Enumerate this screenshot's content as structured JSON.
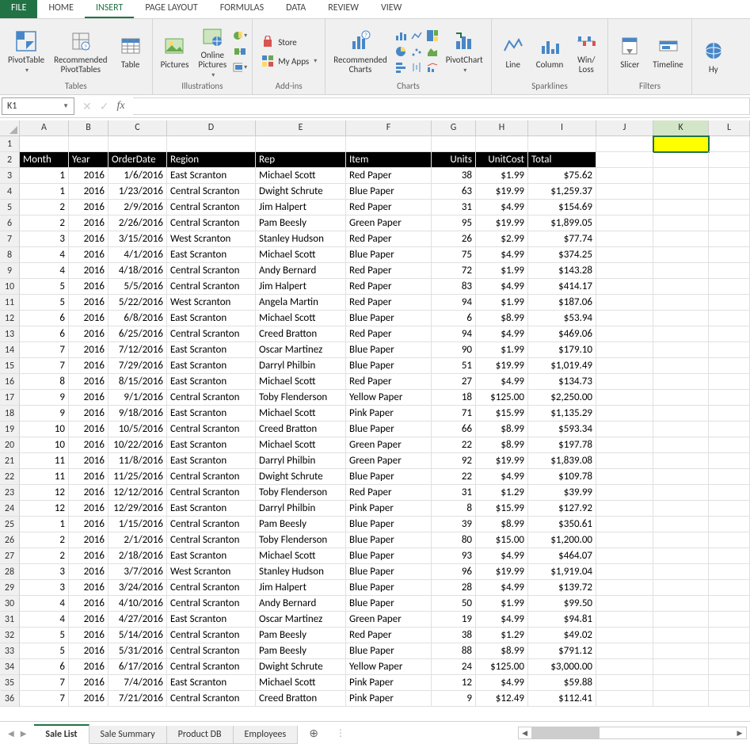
{
  "tabs": {
    "file": "FILE",
    "home": "HOME",
    "insert": "INSERT",
    "page_layout": "PAGE LAYOUT",
    "formulas": "FORMULAS",
    "data": "DATA",
    "review": "REVIEW",
    "view": "VIEW",
    "active": "INSERT"
  },
  "ribbon": {
    "tables": {
      "label": "Tables",
      "pivot": "PivotTable",
      "recommended": "Recommended\nPivotTables",
      "table": "Table"
    },
    "illustrations": {
      "label": "Illustrations",
      "pictures": "Pictures",
      "online": "Online\nPictures"
    },
    "addins": {
      "label": "Add-ins",
      "store": "Store",
      "myapps": "My Apps"
    },
    "charts": {
      "label": "Charts",
      "recommended": "Recommended\nCharts",
      "pivotchart": "PivotChart"
    },
    "sparklines": {
      "label": "Sparklines",
      "line": "Line",
      "column": "Column",
      "winloss": "Win/\nLoss"
    },
    "filters": {
      "label": "Filters",
      "slicer": "Slicer",
      "timeline": "Timeline"
    },
    "links": {
      "label": "",
      "hyperlink": "Hy"
    }
  },
  "name_box": "K1",
  "formula_bar": "",
  "columns": [
    "A",
    "B",
    "C",
    "D",
    "E",
    "F",
    "G",
    "H",
    "I",
    "J",
    "K",
    "L"
  ],
  "selected_col": "K",
  "headers": [
    "Month",
    "Year",
    "OrderDate",
    "Region",
    "Rep",
    "Item",
    "Units",
    "UnitCost",
    "Total"
  ],
  "header_align": [
    "l",
    "l",
    "l",
    "l",
    "l",
    "l",
    "r",
    "r",
    "l"
  ],
  "col_align": [
    "r",
    "r",
    "r",
    "l",
    "l",
    "l",
    "r",
    "r",
    "r"
  ],
  "rows": [
    {
      "n": 3,
      "c": [
        "1",
        "2016",
        "1/6/2016",
        "East Scranton",
        "Michael Scott",
        "Red Paper",
        "38",
        "$1.99",
        "$75.62"
      ]
    },
    {
      "n": 4,
      "c": [
        "1",
        "2016",
        "1/23/2016",
        "Central Scranton",
        "Dwight Schrute",
        "Blue Paper",
        "63",
        "$19.99",
        "$1,259.37"
      ]
    },
    {
      "n": 5,
      "c": [
        "2",
        "2016",
        "2/9/2016",
        "Central Scranton",
        "Jim Halpert",
        "Red Paper",
        "31",
        "$4.99",
        "$154.69"
      ]
    },
    {
      "n": 6,
      "c": [
        "2",
        "2016",
        "2/26/2016",
        "Central Scranton",
        "Pam Beesly",
        "Green Paper",
        "95",
        "$19.99",
        "$1,899.05"
      ]
    },
    {
      "n": 7,
      "c": [
        "3",
        "2016",
        "3/15/2016",
        "West Scranton",
        "Stanley Hudson",
        "Red Paper",
        "26",
        "$2.99",
        "$77.74"
      ]
    },
    {
      "n": 8,
      "c": [
        "4",
        "2016",
        "4/1/2016",
        "East Scranton",
        "Michael Scott",
        "Blue Paper",
        "75",
        "$4.99",
        "$374.25"
      ]
    },
    {
      "n": 9,
      "c": [
        "4",
        "2016",
        "4/18/2016",
        "Central Scranton",
        "Andy Bernard",
        "Red Paper",
        "72",
        "$1.99",
        "$143.28"
      ]
    },
    {
      "n": 10,
      "c": [
        "5",
        "2016",
        "5/5/2016",
        "Central Scranton",
        "Jim Halpert",
        "Red Paper",
        "83",
        "$4.99",
        "$414.17"
      ]
    },
    {
      "n": 11,
      "c": [
        "5",
        "2016",
        "5/22/2016",
        "West Scranton",
        "Angela Martin",
        "Red Paper",
        "94",
        "$1.99",
        "$187.06"
      ]
    },
    {
      "n": 12,
      "c": [
        "6",
        "2016",
        "6/8/2016",
        "East Scranton",
        "Michael Scott",
        "Blue Paper",
        "6",
        "$8.99",
        "$53.94"
      ]
    },
    {
      "n": 13,
      "c": [
        "6",
        "2016",
        "6/25/2016",
        "Central Scranton",
        "Creed Bratton",
        "Red Paper",
        "94",
        "$4.99",
        "$469.06"
      ]
    },
    {
      "n": 14,
      "c": [
        "7",
        "2016",
        "7/12/2016",
        "East Scranton",
        "Oscar Martinez",
        "Blue Paper",
        "90",
        "$1.99",
        "$179.10"
      ]
    },
    {
      "n": 15,
      "c": [
        "7",
        "2016",
        "7/29/2016",
        "East Scranton",
        "Darryl Philbin",
        "Blue Paper",
        "51",
        "$19.99",
        "$1,019.49"
      ]
    },
    {
      "n": 16,
      "c": [
        "8",
        "2016",
        "8/15/2016",
        "East Scranton",
        "Michael Scott",
        "Red Paper",
        "27",
        "$4.99",
        "$134.73"
      ]
    },
    {
      "n": 17,
      "c": [
        "9",
        "2016",
        "9/1/2016",
        "Central Scranton",
        "Toby Flenderson",
        "Yellow Paper",
        "18",
        "$125.00",
        "$2,250.00"
      ]
    },
    {
      "n": 18,
      "c": [
        "9",
        "2016",
        "9/18/2016",
        "East Scranton",
        "Michael Scott",
        "Pink Paper",
        "71",
        "$15.99",
        "$1,135.29"
      ]
    },
    {
      "n": 19,
      "c": [
        "10",
        "2016",
        "10/5/2016",
        "Central Scranton",
        "Creed Bratton",
        "Blue Paper",
        "66",
        "$8.99",
        "$593.34"
      ]
    },
    {
      "n": 20,
      "c": [
        "10",
        "2016",
        "10/22/2016",
        "East Scranton",
        "Michael Scott",
        "Green Paper",
        "22",
        "$8.99",
        "$197.78"
      ]
    },
    {
      "n": 21,
      "c": [
        "11",
        "2016",
        "11/8/2016",
        "East Scranton",
        "Darryl Philbin",
        "Green Paper",
        "92",
        "$19.99",
        "$1,839.08"
      ]
    },
    {
      "n": 22,
      "c": [
        "11",
        "2016",
        "11/25/2016",
        "Central Scranton",
        "Dwight Schrute",
        "Blue Paper",
        "22",
        "$4.99",
        "$109.78"
      ]
    },
    {
      "n": 23,
      "c": [
        "12",
        "2016",
        "12/12/2016",
        "Central Scranton",
        "Toby Flenderson",
        "Red Paper",
        "31",
        "$1.29",
        "$39.99"
      ]
    },
    {
      "n": 24,
      "c": [
        "12",
        "2016",
        "12/29/2016",
        "East Scranton",
        "Darryl Philbin",
        "Pink Paper",
        "8",
        "$15.99",
        "$127.92"
      ]
    },
    {
      "n": 25,
      "c": [
        "1",
        "2016",
        "1/15/2016",
        "Central Scranton",
        "Pam Beesly",
        "Blue Paper",
        "39",
        "$8.99",
        "$350.61"
      ]
    },
    {
      "n": 26,
      "c": [
        "2",
        "2016",
        "2/1/2016",
        "Central Scranton",
        "Toby Flenderson",
        "Blue Paper",
        "80",
        "$15.00",
        "$1,200.00"
      ]
    },
    {
      "n": 27,
      "c": [
        "2",
        "2016",
        "2/18/2016",
        "East Scranton",
        "Michael Scott",
        "Blue Paper",
        "93",
        "$4.99",
        "$464.07"
      ]
    },
    {
      "n": 28,
      "c": [
        "3",
        "2016",
        "3/7/2016",
        "West Scranton",
        "Stanley Hudson",
        "Blue Paper",
        "96",
        "$19.99",
        "$1,919.04"
      ]
    },
    {
      "n": 29,
      "c": [
        "3",
        "2016",
        "3/24/2016",
        "Central Scranton",
        "Jim Halpert",
        "Blue Paper",
        "28",
        "$4.99",
        "$139.72"
      ]
    },
    {
      "n": 30,
      "c": [
        "4",
        "2016",
        "4/10/2016",
        "Central Scranton",
        "Andy Bernard",
        "Blue Paper",
        "50",
        "$1.99",
        "$99.50"
      ]
    },
    {
      "n": 31,
      "c": [
        "4",
        "2016",
        "4/27/2016",
        "East Scranton",
        "Oscar Martinez",
        "Green Paper",
        "19",
        "$4.99",
        "$94.81"
      ]
    },
    {
      "n": 32,
      "c": [
        "5",
        "2016",
        "5/14/2016",
        "Central Scranton",
        "Pam Beesly",
        "Red Paper",
        "38",
        "$1.29",
        "$49.02"
      ]
    },
    {
      "n": 33,
      "c": [
        "5",
        "2016",
        "5/31/2016",
        "Central Scranton",
        "Pam Beesly",
        "Blue Paper",
        "88",
        "$8.99",
        "$791.12"
      ]
    },
    {
      "n": 34,
      "c": [
        "6",
        "2016",
        "6/17/2016",
        "Central Scranton",
        "Dwight Schrute",
        "Yellow Paper",
        "24",
        "$125.00",
        "$3,000.00"
      ]
    },
    {
      "n": 35,
      "c": [
        "7",
        "2016",
        "7/4/2016",
        "East Scranton",
        "Michael Scott",
        "Pink Paper",
        "12",
        "$4.99",
        "$59.88"
      ]
    },
    {
      "n": 36,
      "c": [
        "7",
        "2016",
        "7/21/2016",
        "Central Scranton",
        "Creed Bratton",
        "Pink Paper",
        "9",
        "$12.49",
        "$112.41"
      ]
    }
  ],
  "sheet_tabs": [
    "Sale List",
    "Sale Summary",
    "Product DB",
    "Employees"
  ],
  "active_sheet": "Sale List"
}
